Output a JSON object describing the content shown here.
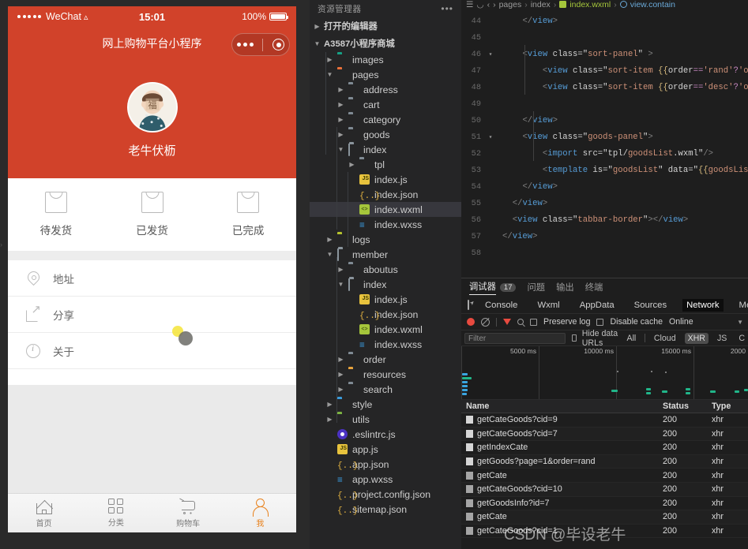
{
  "simulator": {
    "status_bar": {
      "carrier": "WeChat",
      "time": "15:01",
      "battery": "100%"
    },
    "nav_title": "网上购物平台小程序",
    "profile": {
      "nickname": "老牛伏枥"
    },
    "orders": [
      {
        "label": "待发货",
        "icon": "bag-icon"
      },
      {
        "label": "已发货",
        "icon": "bag-icon"
      },
      {
        "label": "已完成",
        "icon": "bag-icon"
      }
    ],
    "menu": [
      {
        "label": "地址",
        "icon": "pin-icon"
      },
      {
        "label": "分享",
        "icon": "share-icon"
      },
      {
        "label": "关于",
        "icon": "info-icon"
      }
    ],
    "tabbar": [
      {
        "label": "首页",
        "icon": "home-icon",
        "active": false
      },
      {
        "label": "分类",
        "icon": "grid-icon",
        "active": false
      },
      {
        "label": "购物车",
        "icon": "cart-icon",
        "active": false
      },
      {
        "label": "我",
        "icon": "user-icon",
        "active": true
      }
    ],
    "accent_color": "#d1422a",
    "tab_active_color": "#e8811c"
  },
  "explorer": {
    "title": "资源管理器",
    "more_label": "•••",
    "open_editors_label": "打开的编辑器",
    "project_label": "A3587小程序商城",
    "tree": [
      {
        "depth": 1,
        "label": "images",
        "kind": "folder",
        "color": "teal",
        "expanded": false
      },
      {
        "depth": 1,
        "label": "pages",
        "kind": "folder",
        "color": "orange",
        "expanded": true
      },
      {
        "depth": 2,
        "label": "address",
        "kind": "folder",
        "color": "grey",
        "expanded": false
      },
      {
        "depth": 2,
        "label": "cart",
        "kind": "folder",
        "color": "grey",
        "expanded": false
      },
      {
        "depth": 2,
        "label": "category",
        "kind": "folder",
        "color": "grey",
        "expanded": false
      },
      {
        "depth": 2,
        "label": "goods",
        "kind": "folder",
        "color": "grey",
        "expanded": false
      },
      {
        "depth": 2,
        "label": "index",
        "kind": "folder-open",
        "color": "grey",
        "expanded": true
      },
      {
        "depth": 3,
        "label": "tpl",
        "kind": "folder",
        "color": "grey",
        "expanded": false
      },
      {
        "depth": 3,
        "label": "index.js",
        "kind": "js"
      },
      {
        "depth": 3,
        "label": "index.json",
        "kind": "json"
      },
      {
        "depth": 3,
        "label": "index.wxml",
        "kind": "wxml",
        "selected": true
      },
      {
        "depth": 3,
        "label": "index.wxss",
        "kind": "wxss"
      },
      {
        "depth": 1,
        "label": "logs",
        "kind": "folder",
        "color": "yellowgreen",
        "expanded": false
      },
      {
        "depth": 1,
        "label": "member",
        "kind": "folder-open",
        "color": "grey",
        "expanded": true
      },
      {
        "depth": 2,
        "label": "aboutus",
        "kind": "folder",
        "color": "grey",
        "expanded": false
      },
      {
        "depth": 2,
        "label": "index",
        "kind": "folder-open",
        "color": "grey",
        "expanded": true
      },
      {
        "depth": 3,
        "label": "index.js",
        "kind": "js"
      },
      {
        "depth": 3,
        "label": "index.json",
        "kind": "json"
      },
      {
        "depth": 3,
        "label": "index.wxml",
        "kind": "wxml"
      },
      {
        "depth": 3,
        "label": "index.wxss",
        "kind": "wxss"
      },
      {
        "depth": 2,
        "label": "order",
        "kind": "folder",
        "color": "grey",
        "expanded": false
      },
      {
        "depth": 2,
        "label": "resources",
        "kind": "folder",
        "color": "amber",
        "expanded": false
      },
      {
        "depth": 2,
        "label": "search",
        "kind": "folder",
        "color": "grey",
        "expanded": false
      },
      {
        "depth": 1,
        "label": "style",
        "kind": "folder",
        "color": "blue",
        "expanded": false
      },
      {
        "depth": 1,
        "label": "utils",
        "kind": "folder",
        "color": "green",
        "expanded": false
      },
      {
        "depth": 1,
        "label": ".eslintrc.js",
        "kind": "eslint"
      },
      {
        "depth": 1,
        "label": "app.js",
        "kind": "js"
      },
      {
        "depth": 1,
        "label": "app.json",
        "kind": "json"
      },
      {
        "depth": 1,
        "label": "app.wxss",
        "kind": "wxss"
      },
      {
        "depth": 1,
        "label": "project.config.json",
        "kind": "json"
      },
      {
        "depth": 1,
        "label": "sitemap.json",
        "kind": "json"
      }
    ]
  },
  "editor": {
    "breadcrumb": [
      "pages",
      "index",
      "index.wxml",
      "view.contain"
    ],
    "lines": [
      {
        "num": "44",
        "fold": "",
        "text": "    </view>"
      },
      {
        "num": "45",
        "fold": "",
        "text": ""
      },
      {
        "num": "46",
        "fold": "v",
        "text": "    <view class=\"sort-panel\" >"
      },
      {
        "num": "47",
        "fold": "",
        "text": "        <view class=\"sort-item {{order=='rand'?'on':'"
      },
      {
        "num": "48",
        "fold": "",
        "text": "        <view class=\"sort-item {{order=='desc'?'on':'"
      },
      {
        "num": "49",
        "fold": "",
        "text": ""
      },
      {
        "num": "50",
        "fold": "",
        "text": "    </view>"
      },
      {
        "num": "51",
        "fold": "v",
        "text": "    <view class=\"goods-panel\">"
      },
      {
        "num": "52",
        "fold": "",
        "text": "        <import src=\"tpl/goodsList.wxml\"/>"
      },
      {
        "num": "53",
        "fold": "",
        "text": "        <template is=\"goodsList\" data=\"{{goodsList:go"
      },
      {
        "num": "54",
        "fold": "",
        "text": "    </view>"
      },
      {
        "num": "55",
        "fold": "",
        "text": "  </view>"
      },
      {
        "num": "56",
        "fold": "",
        "text": "  <view class=\"tabbar-border\"></view>"
      },
      {
        "num": "57",
        "fold": "",
        "text": "</view>"
      },
      {
        "num": "58",
        "fold": "",
        "text": ""
      }
    ]
  },
  "debugger": {
    "panel_tabs": [
      {
        "label": "调试器",
        "badge": "17",
        "active": true
      },
      {
        "label": "问题",
        "badge": "",
        "active": false
      },
      {
        "label": "输出",
        "badge": "",
        "active": false
      },
      {
        "label": "终端",
        "badge": "",
        "active": false
      }
    ],
    "devtool_tabs": [
      {
        "label": "Console",
        "active": false
      },
      {
        "label": "Wxml",
        "active": false
      },
      {
        "label": "AppData",
        "active": false
      },
      {
        "label": "Sources",
        "active": false
      },
      {
        "label": "Network",
        "active": true
      },
      {
        "label": "Memory",
        "active": false
      }
    ],
    "controls": {
      "preserve_log": "Preserve log",
      "disable_cache": "Disable cache",
      "throttling": "Online"
    },
    "filter": {
      "placeholder": "Filter",
      "hide_data_urls": "Hide data URLs",
      "types": [
        {
          "label": "All",
          "active": false
        },
        {
          "label": "Cloud",
          "active": false
        },
        {
          "label": "XHR",
          "active": true
        },
        {
          "label": "JS",
          "active": false
        },
        {
          "label": "C",
          "active": false
        }
      ]
    },
    "timeline": {
      "ticks": [
        "5000 ms",
        "10000 ms",
        "15000 ms",
        "2000"
      ]
    },
    "columns": [
      "Name",
      "Status",
      "Type"
    ],
    "requests": [
      {
        "name": "getCateGoods?cid=9",
        "status": "200",
        "type": "xhr"
      },
      {
        "name": "getCateGoods?cid=7",
        "status": "200",
        "type": "xhr"
      },
      {
        "name": "getIndexCate",
        "status": "200",
        "type": "xhr"
      },
      {
        "name": "getGoods?page=1&order=rand",
        "status": "200",
        "type": "xhr"
      },
      {
        "name": "getCate",
        "status": "200",
        "type": "xhr"
      },
      {
        "name": "getCateGoods?cid=10",
        "status": "200",
        "type": "xhr"
      },
      {
        "name": "getGoodsInfo?id=7",
        "status": "200",
        "type": "xhr"
      },
      {
        "name": "getCate",
        "status": "200",
        "type": "xhr"
      },
      {
        "name": "getCateGoods?cid=1",
        "status": "200",
        "type": "xhr"
      }
    ]
  },
  "watermark": "CSDN @毕设老牛"
}
